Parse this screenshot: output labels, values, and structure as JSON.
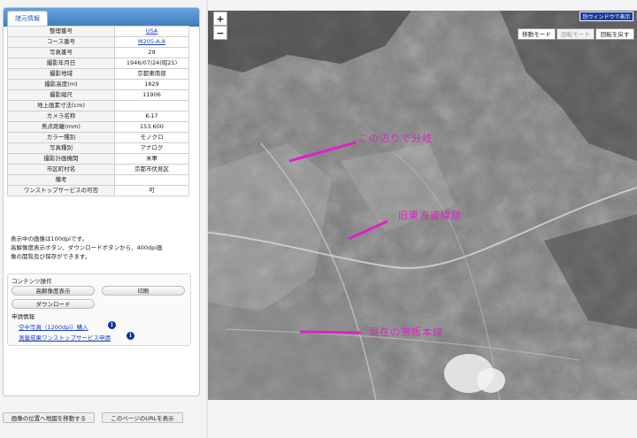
{
  "panel": {
    "tab_label": "諸元情報"
  },
  "info_rows": [
    {
      "label": "整理番号",
      "value": "USA",
      "link": true
    },
    {
      "label": "コース番号",
      "value": "M205-A-8",
      "link": true
    },
    {
      "label": "写真番号",
      "value": "29",
      "link": false
    },
    {
      "label": "撮影年月日",
      "value": "1946/07/24(昭21)",
      "link": false
    },
    {
      "label": "撮影地域",
      "value": "京都東南部",
      "link": false
    },
    {
      "label": "撮影高度(m)",
      "value": "1829",
      "link": false
    },
    {
      "label": "撮影縮尺",
      "value": "11906",
      "link": false
    },
    {
      "label": "地上画素寸法(cm)",
      "value": "",
      "link": false
    },
    {
      "label": "カメラ名称",
      "value": "K-17",
      "link": false
    },
    {
      "label": "焦点距離(mm)",
      "value": "153.600",
      "link": false
    },
    {
      "label": "カラー種別",
      "value": "モノクロ",
      "link": false
    },
    {
      "label": "写真種別",
      "value": "アナログ",
      "link": false
    },
    {
      "label": "撮影計画機関",
      "value": "米軍",
      "link": false
    },
    {
      "label": "市区町村名",
      "value": "京都市伏見区",
      "link": false
    },
    {
      "label": "備考",
      "value": "",
      "link": false
    },
    {
      "label": "ワンストップサービスの可否",
      "value": "可",
      "link": false
    }
  ],
  "note": {
    "line1": "表示中の画像は100dpiです。",
    "line2": "高解像度表示ボタン、ダウンロードボタンから、400dpi画",
    "line3": "像の閲覧及び保存ができます。"
  },
  "contents": {
    "title": "コンテンツ操作",
    "hires_label": "高解像度表示",
    "print_label": "印刷",
    "download_label": "ダウンロード",
    "apply_title": "申請情報",
    "purchase_link": "空中写真（1200dpi）購入",
    "onestop_link": "測量成果ワンストップサービス申請"
  },
  "bottom": {
    "move_map_label": "画像の位置へ地図を移動する",
    "show_url_label": "このページのURLを表示"
  },
  "map": {
    "zoom_in": "+",
    "zoom_out": "−",
    "new_window_label": "別ウィンドウで表示",
    "move_mode_label": "移動モード",
    "rotate_mode_label": "回転モード",
    "reset_rotation_label": "回転を戻す",
    "annotations": {
      "a1": "この辺りで分岐",
      "a2": "旧東海道線跡",
      "a3": "現在の京阪本線"
    }
  },
  "colors": {
    "accent": "#3f7fc0",
    "annotation": "#e020c8",
    "link": "#1a3dc4"
  }
}
